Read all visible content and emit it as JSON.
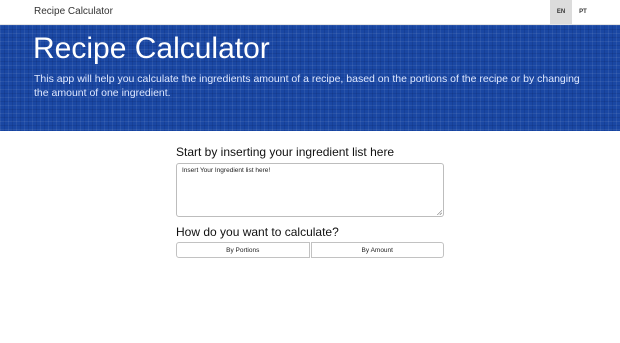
{
  "navbar": {
    "brand": "Recipe Calculator",
    "languages": [
      {
        "code": "EN",
        "active": true
      },
      {
        "code": "PT",
        "active": false
      }
    ]
  },
  "hero": {
    "title": "Recipe Calculator",
    "description": "This app will help you calculate the ingredients amount of a recipe, based on the portions of the recipe or by changing the amount of one ingredient.",
    "background_color": "#1a47a3"
  },
  "ingredients": {
    "heading": "Start by inserting your ingredient list here",
    "placeholder": "Insert Your Ingredient list here!",
    "value": ""
  },
  "calculation": {
    "heading": "How do you want to calculate?",
    "options": [
      {
        "label": "By Portions"
      },
      {
        "label": "By Amount"
      }
    ]
  }
}
